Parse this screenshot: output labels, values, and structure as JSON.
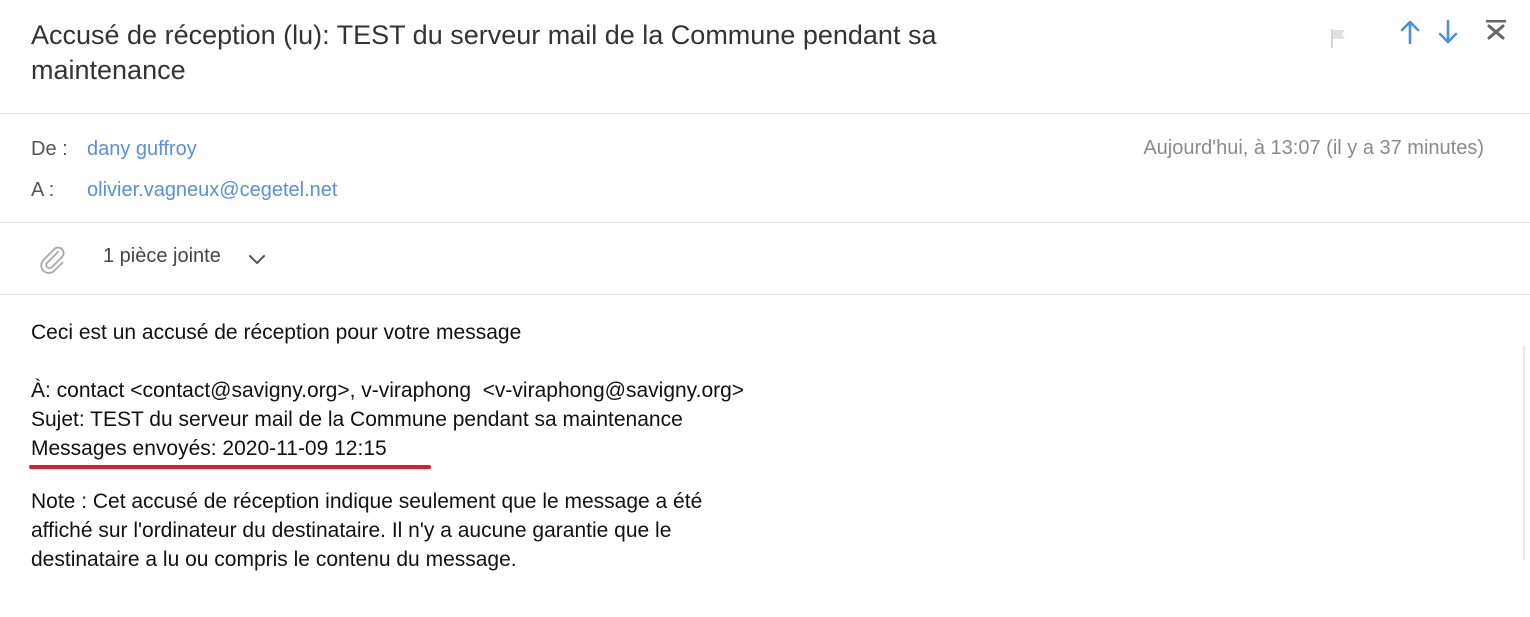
{
  "header": {
    "subject": "Accusé de réception (lu): TEST du serveur mail de la Commune pendant sa maintenance"
  },
  "meta": {
    "from_label": "De :",
    "from_value": "dany guffroy",
    "to_label": "A :",
    "to_value": "olivier.vagneux@cegetel.net",
    "date": "Aujourd'hui, à 13:07 (il y a 37 minutes)"
  },
  "attachments": {
    "label": "1 pièce jointe"
  },
  "body": {
    "intro": "Ceci est un accusé de réception pour votre message",
    "to_line": "À: contact <contact@savigny.org>, v-viraphong  <v-viraphong@savigny.org>",
    "subject_line": "Sujet: TEST du serveur mail de la Commune pendant sa maintenance",
    "sent_line": "Messages envoyés: 2020-11-09 12:15",
    "note_1": "Note : Cet accusé de réception indique seulement que le message a été",
    "note_2": "affiché sur l'ordinateur du destinataire. Il n'y a aucune garantie que le",
    "note_3": "destinataire a lu ou compris le contenu du message."
  },
  "colors": {
    "link": "#5b8fd6",
    "nav_arrow": "#4a90e2",
    "highlight_underline": "#d6202e"
  },
  "icons": [
    "flag-icon",
    "arrow-up-icon",
    "arrow-down-icon",
    "close-icon",
    "paperclip-icon",
    "chevron-down-icon"
  ]
}
